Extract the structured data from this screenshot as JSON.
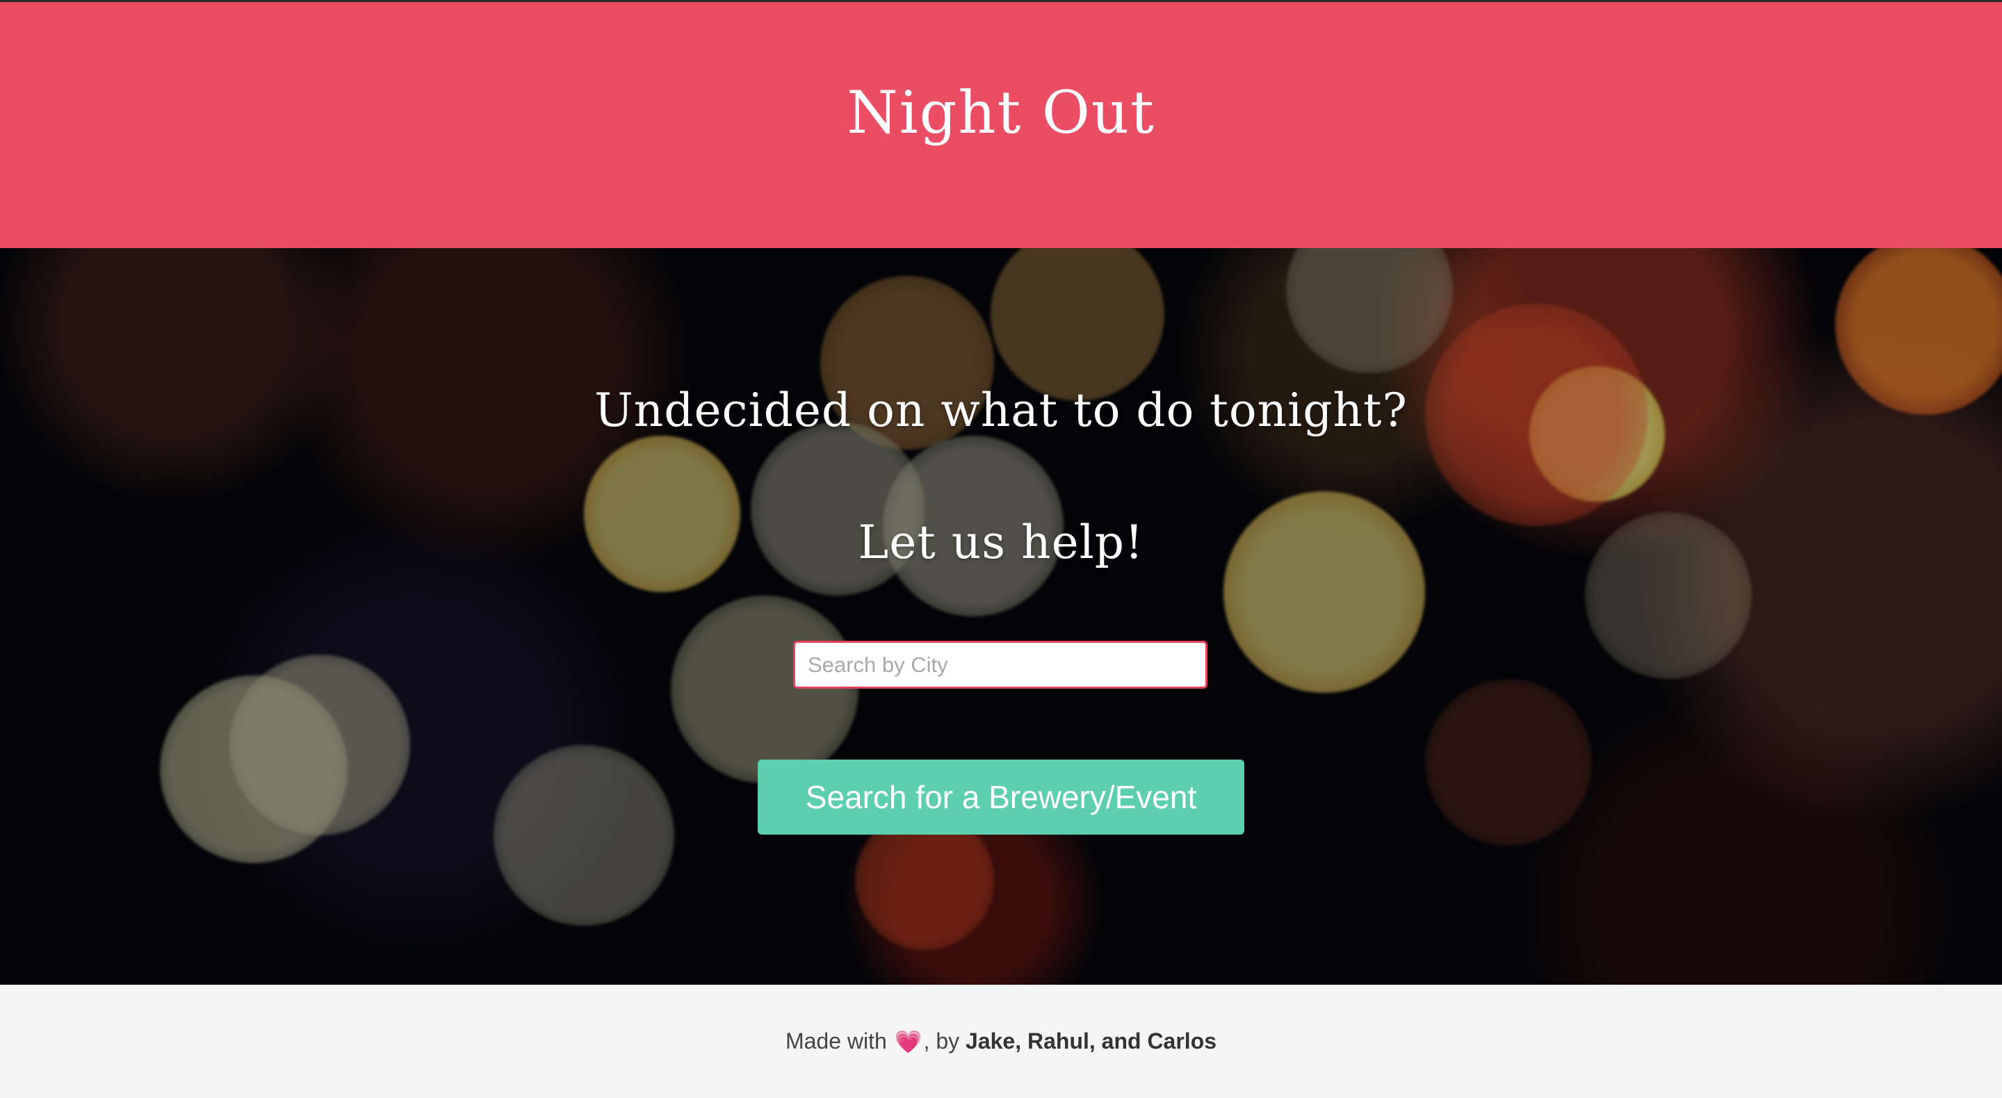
{
  "header": {
    "title": "Night Out",
    "background_color": "#eb4d65"
  },
  "hero": {
    "headline": "Undecided on what to do tonight?",
    "subheadline": "Let us help!",
    "search": {
      "placeholder": "Search by City",
      "value": ""
    },
    "button_label": "Search for a Brewery/Event",
    "button_color": "#5ecfae"
  },
  "footer": {
    "prefix": "Made with",
    "heart": "💗",
    "middle": ", by",
    "authors": "Jake, Rahul, and Carlos"
  }
}
